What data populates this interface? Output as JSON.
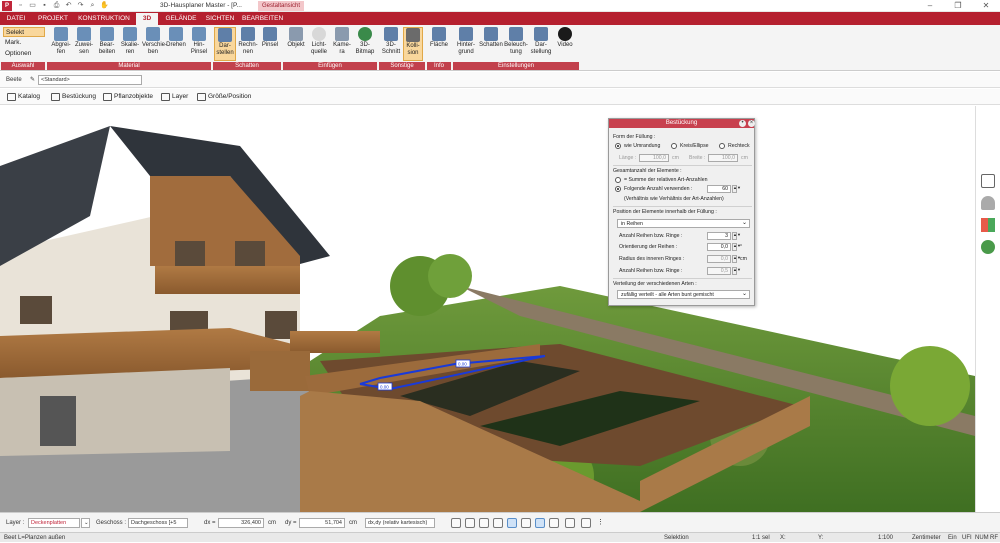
{
  "titlebar": {
    "title": "3D-Hausplaner Master - [P...",
    "context_tab": "Gestaltansicht",
    "controls": {
      "minimize": "–",
      "restore": "❐",
      "close": "✕"
    }
  },
  "menu": {
    "tabs": [
      {
        "label": "DATEI"
      },
      {
        "label": "PROJEKT"
      },
      {
        "label": "KONSTRUKTION"
      },
      {
        "label": "3D"
      },
      {
        "label": "GELÄNDE"
      },
      {
        "label": "SICHTEN"
      },
      {
        "label": "BEARBEITEN"
      }
    ],
    "active": "3D"
  },
  "ribbon": {
    "auswahl": {
      "selekt": "Selekt",
      "mark": "Mark.",
      "optionen": "Optionen"
    },
    "material": [
      "Abgrei-\nfen",
      "Zuwei-\nsen",
      "Bear-\nbeiten",
      "Skalie-\nren",
      "Verschie-\nben",
      "Drehen",
      "Hin-\nPinsel"
    ],
    "schatten": [
      "Dar-\nstellen",
      "Rechn-\nnen",
      "Pinsel"
    ],
    "einfuegen": [
      "Objekt",
      "Licht-\nquelle",
      "Kame-\nra",
      "3D-\nBitmap"
    ],
    "sonstige": [
      "3D-\nSchnitt",
      "Kolli-\nsion"
    ],
    "info": [
      "Fläche"
    ],
    "einstellungen": [
      "Hinter-\ngrund",
      "Schatten",
      "Beleuch-\ntung",
      "Dar-\nstellung",
      "Video"
    ],
    "groups": [
      "Auswahl",
      "Material",
      "Schatten",
      "Einfügen",
      "Sonstige",
      "Info",
      "Einstellungen"
    ]
  },
  "bar2": {
    "label": "Beete",
    "value": "<Standard>"
  },
  "bar3": {
    "items": [
      "Katalog",
      "Bestückung",
      "Pflanzobjekte",
      "Layer",
      "Größe/Position"
    ]
  },
  "viewport": {
    "tags": [
      "0.00",
      "0.00"
    ]
  },
  "dialog": {
    "title": "Bestückung",
    "form_label": "Form der Füllung :",
    "form_options": [
      "wie Umrandung",
      "Kreis/Ellipse",
      "Rechteck"
    ],
    "laenge_label": "Länge :",
    "laenge_value": "100,0",
    "breite_label": "Breite :",
    "breite_value": "100,0",
    "unit_cm": "cm",
    "gesamt_label": "Gesamtanzahl der Elemente :",
    "gesamt_opt1": "= Summe der relativen Art-Anzahlen",
    "gesamt_opt2": "Folgende Anzahl verwenden :",
    "gesamt_value": "60",
    "verhaeltnis_note": "(Verhältnis wie Verhältnis der Art-Anzahlen)",
    "position_label": "Position der Elemente innerhalb der Füllung :",
    "position_value": "in Reihen",
    "reihen_label": "Anzahl Reihen bzw. Ringe :",
    "reihen_value": "3",
    "orient_label": "Orientierung der Reihen :",
    "orient_value": "0,0",
    "orient_unit": "°",
    "radius_label": "Radius des inneren Ringes :",
    "radius_value": "0,0",
    "reihen2_label": "Anzahl Reihen bzw. Ringe :",
    "reihen2_value": "0,5",
    "verteilung_label": "Verteilung der verschiedenen Arten :",
    "verteilung_value": "zufällig verteilt - alle Arten bunt gemischt"
  },
  "status": {
    "layer_label": "Layer :",
    "layer_value": "Deckenplatten",
    "geschoss_label": "Geschoss :",
    "geschoss_value": "Dachgeschoss [+5",
    "dx_label": "dx =",
    "dx_value": "326,400",
    "dx_unit": "cm",
    "dy_label": "dy =",
    "dy_value": "51,704",
    "dy_unit": "cm",
    "mode_value": "dx,dy (relativ kartesisch)",
    "hint": "Beet L=Planzen außen",
    "selektion": "Selektion",
    "scale_a": "1:1 sel",
    "x_label": "X:",
    "y_label": "Y:",
    "scale_b": "1:100",
    "unit": "Zentimeter",
    "ein": "Ein",
    "ufi": "UFI",
    "num": "NUM",
    "rf": "RF"
  },
  "colors": {
    "brand": "#b5202f",
    "ribbon_label": "#c2404c",
    "highlight": "#f9d79c"
  }
}
